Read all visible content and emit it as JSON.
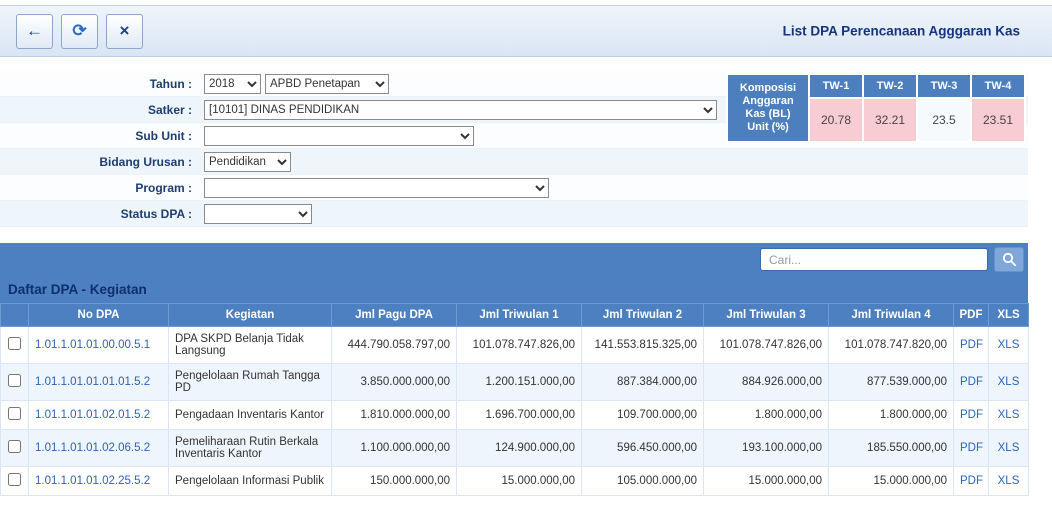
{
  "toolbar": {
    "back_icon": "←",
    "refresh_icon": "⟳",
    "close_icon": "×",
    "title": "List DPA Perencanaan Agggaran Kas"
  },
  "filter_form": {
    "tahun_label": "Tahun :",
    "tahun_value": "2018",
    "apbd_value": "APBD Penetapan",
    "satker_label": "Satker :",
    "satker_value": "[10101] DINAS PENDIDIKAN",
    "subunit_label": "Sub Unit :",
    "subunit_value": "",
    "bidang_label": "Bidang Urusan :",
    "bidang_value": "Pendidikan",
    "program_label": "Program :",
    "program_value": "",
    "status_label": "Status DPA :",
    "status_value": ""
  },
  "komposisi": {
    "header": "Komposisi Anggaran Kas (BL) Unit (%)",
    "columns": [
      "TW-1",
      "TW-2",
      "TW-3",
      "TW-4"
    ],
    "values": [
      "20.78",
      "32.21",
      "23.5",
      "23.51"
    ]
  },
  "search": {
    "placeholder": "Cari..."
  },
  "table": {
    "section_title": "Daftar DPA - Kegiatan",
    "headers": [
      "No DPA",
      "Kegiatan",
      "Jml Pagu DPA",
      "Jml Triwulan 1",
      "Jml Triwulan 2",
      "Jml Triwulan 3",
      "Jml Triwulan 4",
      "PDF",
      "XLS"
    ],
    "pdf_label": "PDF",
    "xls_label": "XLS",
    "rows": [
      {
        "no_dpa": "1.01.1.01.01.00.00.5.1",
        "kegiatan": "DPA SKPD Belanja Tidak Langsung",
        "pagu": "444.790.058.797,00",
        "tw1": "101.078.747.826,00",
        "tw2": "141.553.815.325,00",
        "tw3": "101.078.747.826,00",
        "tw4": "101.078.747.820,00"
      },
      {
        "no_dpa": "1.01.1.01.01.01.01.5.2",
        "kegiatan": "Pengelolaan Rumah Tangga PD",
        "pagu": "3.850.000.000,00",
        "tw1": "1.200.151.000,00",
        "tw2": "887.384.000,00",
        "tw3": "884.926.000,00",
        "tw4": "877.539.000,00"
      },
      {
        "no_dpa": "1.01.1.01.01.02.01.5.2",
        "kegiatan": "Pengadaan Inventaris Kantor",
        "pagu": "1.810.000.000,00",
        "tw1": "1.696.700.000,00",
        "tw2": "109.700.000,00",
        "tw3": "1.800.000,00",
        "tw4": "1.800.000,00"
      },
      {
        "no_dpa": "1.01.1.01.01.02.06.5.2",
        "kegiatan": "Pemeliharaan Rutin Berkala Inventaris Kantor",
        "pagu": "1.100.000.000,00",
        "tw1": "124.900.000,00",
        "tw2": "596.450.000,00",
        "tw3": "193.100.000,00",
        "tw4": "185.550.000,00"
      },
      {
        "no_dpa": "1.01.1.01.01.02.25.5.2",
        "kegiatan": "Pengelolaan Informasi Publik",
        "pagu": "150.000.000,00",
        "tw1": "15.000.000,00",
        "tw2": "105.000.000,00",
        "tw3": "15.000.000,00",
        "tw4": "15.000.000,00"
      }
    ]
  }
}
